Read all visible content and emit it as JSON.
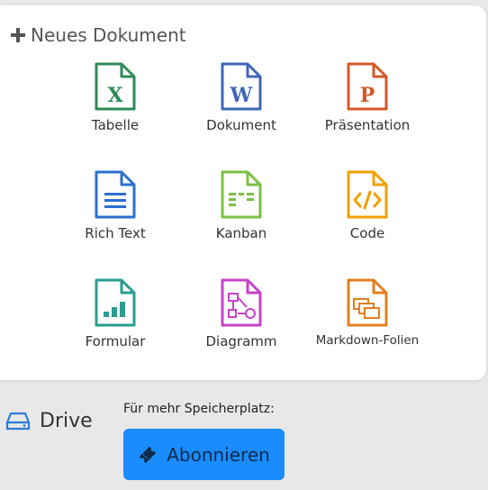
{
  "new_document": {
    "title": "Neues Dokument",
    "items": [
      {
        "label": "Tabelle",
        "icon": "spreadsheet-icon",
        "color": "#2e8b57",
        "glyph": "X"
      },
      {
        "label": "Dokument",
        "icon": "word-document-icon",
        "color": "#3f67b6",
        "glyph": "W"
      },
      {
        "label": "Präsentation",
        "icon": "presentation-icon",
        "color": "#d4582a",
        "glyph": "P"
      },
      {
        "label": "Rich Text",
        "icon": "rich-text-icon",
        "color": "#2b6fd0"
      },
      {
        "label": "Kanban",
        "icon": "kanban-icon",
        "color": "#7ac143"
      },
      {
        "label": "Code",
        "icon": "code-icon",
        "color": "#f0a000"
      },
      {
        "label": "Formular",
        "icon": "form-icon",
        "color": "#2a9d8f"
      },
      {
        "label": "Diagramm",
        "icon": "diagram-icon",
        "color": "#c742c7"
      },
      {
        "label": "Markdown-Folien",
        "icon": "markdown-slides-icon",
        "color": "#e37f1f"
      }
    ]
  },
  "drive": {
    "label": "Drive",
    "icon": "drive-icon"
  },
  "storage_promo": {
    "text": "Für mehr Speicherplatz:",
    "button_label": "Abonnieren",
    "button_icon": "ticket-icon",
    "button_color": "#1a8cff"
  }
}
